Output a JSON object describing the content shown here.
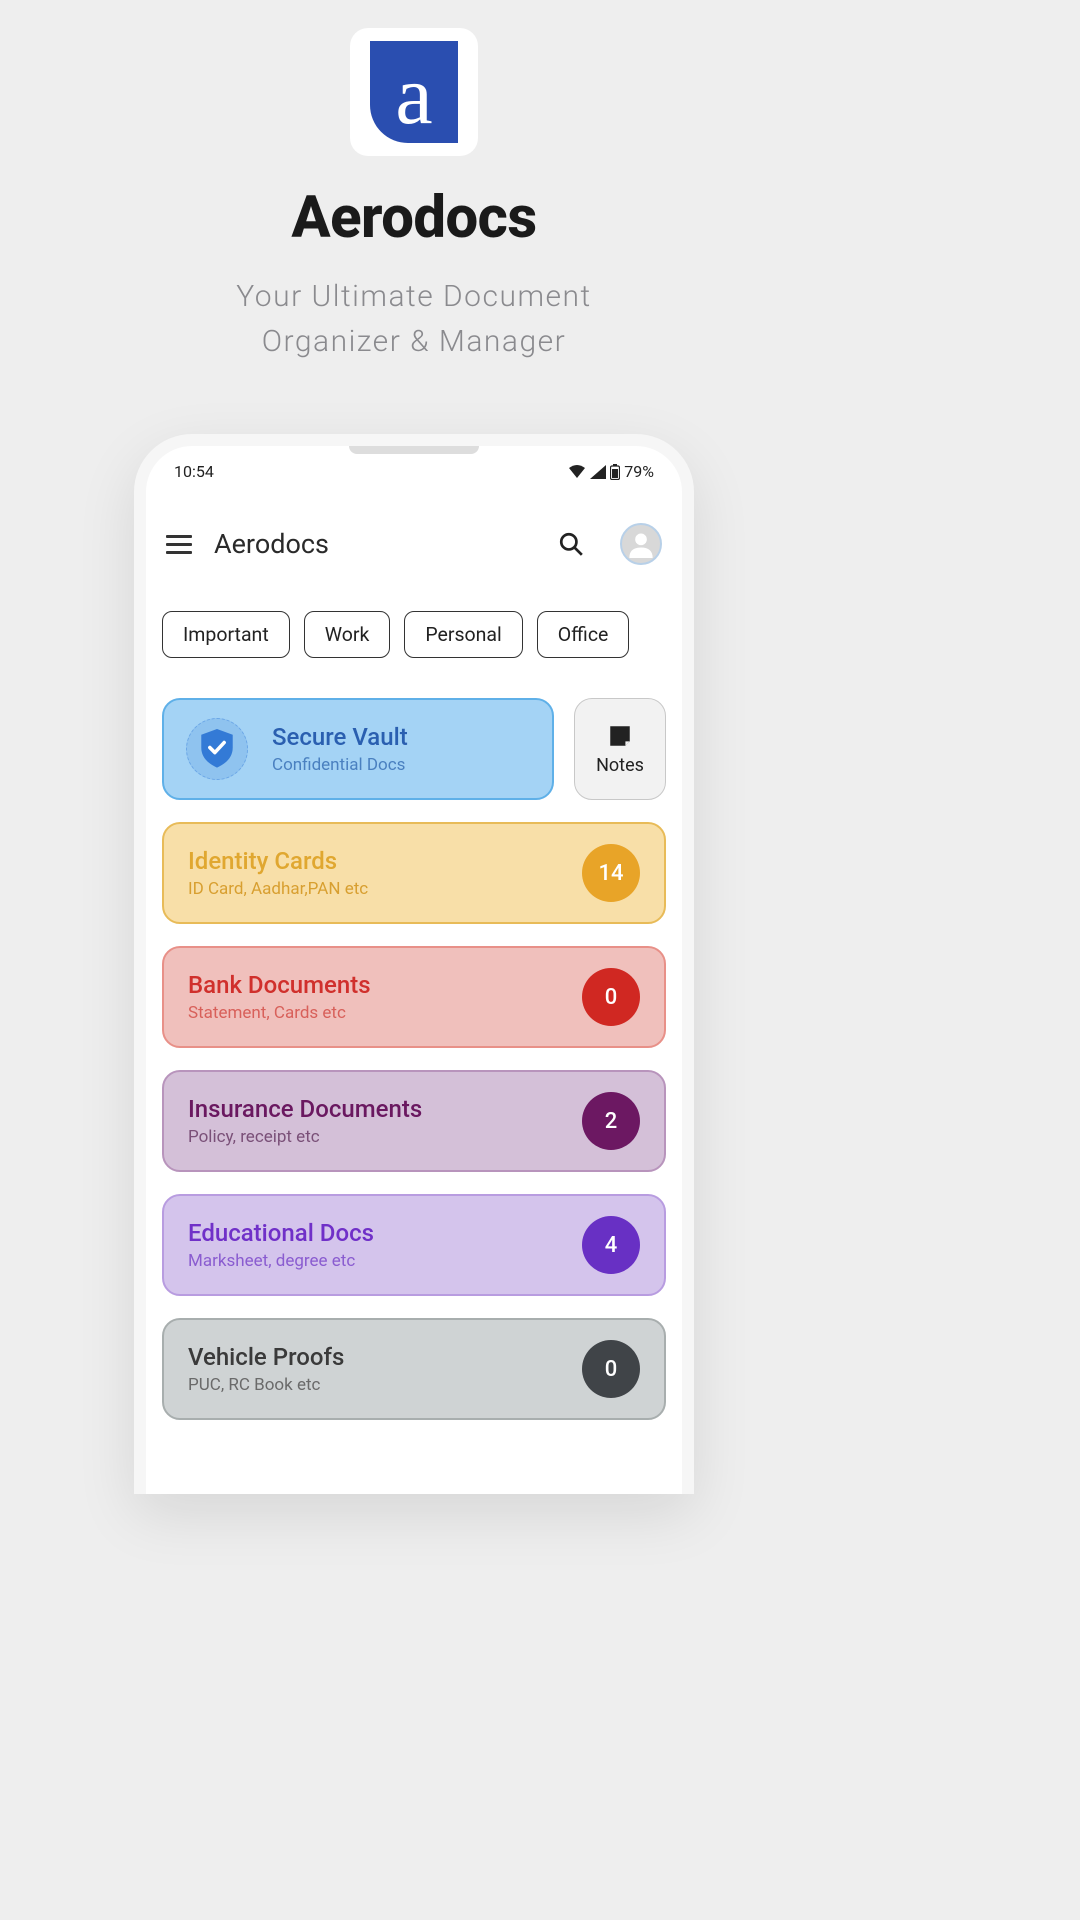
{
  "promo": {
    "title": "Aerodocs",
    "subtitle_l1": "Your Ultimate Document",
    "subtitle_l2": "Organizer & Manager",
    "logo_letter": "a"
  },
  "status": {
    "time": "10:54",
    "battery": "79%"
  },
  "header": {
    "title": "Aerodocs"
  },
  "chips": [
    "Important",
    "Work",
    "Personal",
    "Office"
  ],
  "vault": {
    "title": "Secure Vault",
    "sub": "Confidential Docs"
  },
  "notes": {
    "label": "Notes"
  },
  "categories": [
    {
      "title": "Identity Cards",
      "sub": "ID Card, Aadhar,PAN etc",
      "count": "14",
      "bg": "#f8dfa8",
      "border": "#e8bb58",
      "title_color": "#e0a730",
      "sub_color": "#d89f30",
      "badge_bg": "#e8a428"
    },
    {
      "title": "Bank Documents",
      "sub": "Statement, Cards etc",
      "count": "0",
      "bg": "#f0c0bc",
      "border": "#e89088",
      "title_color": "#d0302c",
      "sub_color": "#d8605a",
      "badge_bg": "#d02822"
    },
    {
      "title": "Insurance Documents",
      "sub": "Policy, receipt etc",
      "count": "2",
      "bg": "#d4c0d8",
      "border": "#b894bc",
      "title_color": "#6a1860",
      "sub_color": "#7a5078",
      "badge_bg": "#6c1862"
    },
    {
      "title": "Educational Docs",
      "sub": "Marksheet, degree etc",
      "count": "4",
      "bg": "#d4c4ec",
      "border": "#b89ce0",
      "title_color": "#7030c8",
      "sub_color": "#8a5cd0",
      "badge_bg": "#6830c4"
    },
    {
      "title": "Vehicle Proofs",
      "sub": "PUC, RC Book etc",
      "count": "0",
      "bg": "#cfd3d4",
      "border": "#a8aeae",
      "title_color": "#3a3a3a",
      "sub_color": "#6a6a6a",
      "badge_bg": "#404448"
    }
  ]
}
